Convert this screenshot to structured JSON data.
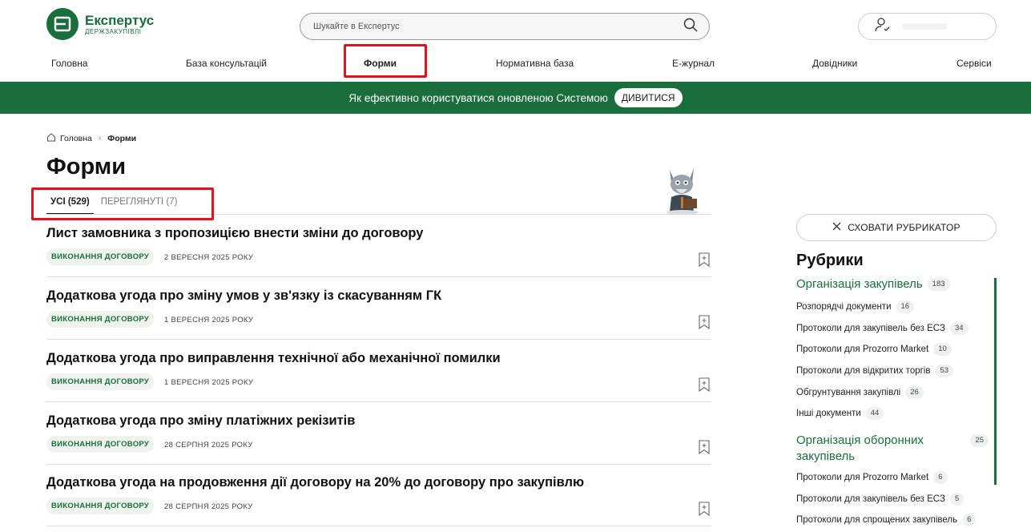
{
  "header": {
    "logo_name": "Експертус",
    "logo_sub": "ДЕРЖЗАКУПІВЛІ",
    "search_placeholder": "Шукайте в Експертус"
  },
  "nav": {
    "items": [
      {
        "label": "Головна"
      },
      {
        "label": "База консультацій"
      },
      {
        "label": "Форми"
      },
      {
        "label": "Нормативна база"
      },
      {
        "label": "Е-журнал"
      },
      {
        "label": "Довідники"
      },
      {
        "label": "Сервіси"
      }
    ],
    "active": "Форми"
  },
  "banner": {
    "text": "Як ефективно користуватися оновленою Системою",
    "button": "ДИВИТИСЯ"
  },
  "breadcrumb": {
    "home": "Головна",
    "current": "Форми"
  },
  "page_title": "Форми",
  "tabs": [
    {
      "label": "УСІ (529)",
      "active": true
    },
    {
      "label": "ПЕРЕГЛЯНУТІ (7)",
      "active": false
    }
  ],
  "items": [
    {
      "title": "Лист замовника з пропозицією внести зміни до договору",
      "tag": "ВИКОНАННЯ ДОГОВОРУ",
      "date": "2 ВЕРЕСНЯ 2025 РОКУ"
    },
    {
      "title": "Додаткова угода про зміну умов у зв'язку із скасуванням ГК",
      "tag": "ВИКОНАННЯ ДОГОВОРУ",
      "date": "1 ВЕРЕСНЯ 2025 РОКУ"
    },
    {
      "title": "Додаткова угода про виправлення технічної або механічної помилки",
      "tag": "ВИКОНАННЯ ДОГОВОРУ",
      "date": "1 ВЕРЕСНЯ 2025 РОКУ"
    },
    {
      "title": "Додаткова угода про зміну платіжних рекізитів",
      "tag": "ВИКОНАННЯ ДОГОВОРУ",
      "date": "28 СЕРПНЯ 2025 РОКУ"
    },
    {
      "title": "Додаткова угода на продовження дії договору на 20% до договору про закупівлю",
      "tag": "ВИКОНАННЯ ДОГОВОРУ",
      "date": "28 СЕРПНЯ 2025 РОКУ"
    }
  ],
  "sidebar": {
    "hide_button": "СХОВАТИ РУБРИКАТОР",
    "title": "Рубрики",
    "rubrics": [
      {
        "label": "Організація закупівель",
        "count": "183",
        "group": true
      },
      {
        "label": "Розпорядчі документи",
        "count": "16",
        "group": false
      },
      {
        "label": "Протоколи для закупівель без ЕСЗ",
        "count": "34",
        "group": false
      },
      {
        "label": "Протоколи для Prozorro Market",
        "count": "10",
        "group": false
      },
      {
        "label": "Протоколи для відкритих торгів",
        "count": "53",
        "group": false
      },
      {
        "label": "Обгрунтування закупівлі",
        "count": "26",
        "group": false
      },
      {
        "label": "Інші документи",
        "count": "44",
        "group": false
      },
      {
        "label": "Організація оборонних закупівель",
        "count": "25",
        "group": true
      },
      {
        "label": "Протоколи для Prozorro Market",
        "count": "6",
        "group": false
      },
      {
        "label": "Протоколи для закупівель без ЕСЗ",
        "count": "5",
        "group": false
      },
      {
        "label": "Протоколи для спрощених закупівель",
        "count": "6",
        "group": false
      }
    ]
  },
  "colors": {
    "brand": "#1a6e3c",
    "highlight": "#e0141e"
  }
}
